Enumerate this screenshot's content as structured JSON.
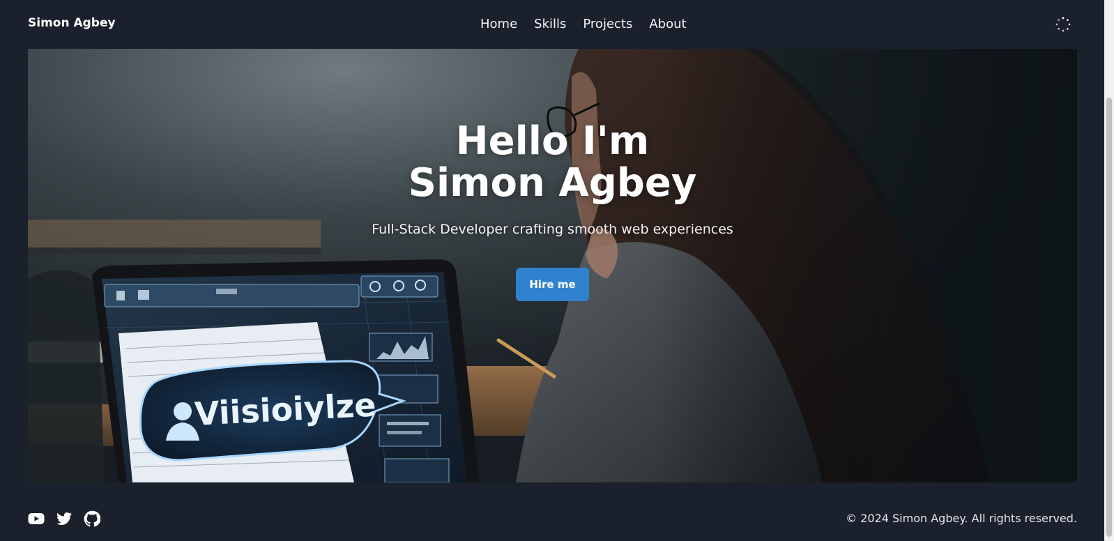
{
  "header": {
    "brand": "Simon Agbey",
    "nav": [
      {
        "label": "Home"
      },
      {
        "label": "Skills"
      },
      {
        "label": "Projects"
      },
      {
        "label": "About"
      }
    ],
    "theme_toggle_icon": "loading-spinner-icon"
  },
  "hero": {
    "title_line1": "Hello I'm",
    "title_line2": "Simon Agbey",
    "subtitle": "Full-Stack Developer crafting smooth web experiences",
    "cta_label": "Hire me",
    "screen_logo_text": "Viisioiylze"
  },
  "footer": {
    "social": [
      {
        "icon": "youtube-icon"
      },
      {
        "icon": "twitter-icon"
      },
      {
        "icon": "github-icon"
      }
    ],
    "copyright": "© 2024 Simon Agbey. All rights reserved."
  },
  "colors": {
    "background": "#1a202c",
    "accent": "#3182ce",
    "text": "#ffffff"
  }
}
